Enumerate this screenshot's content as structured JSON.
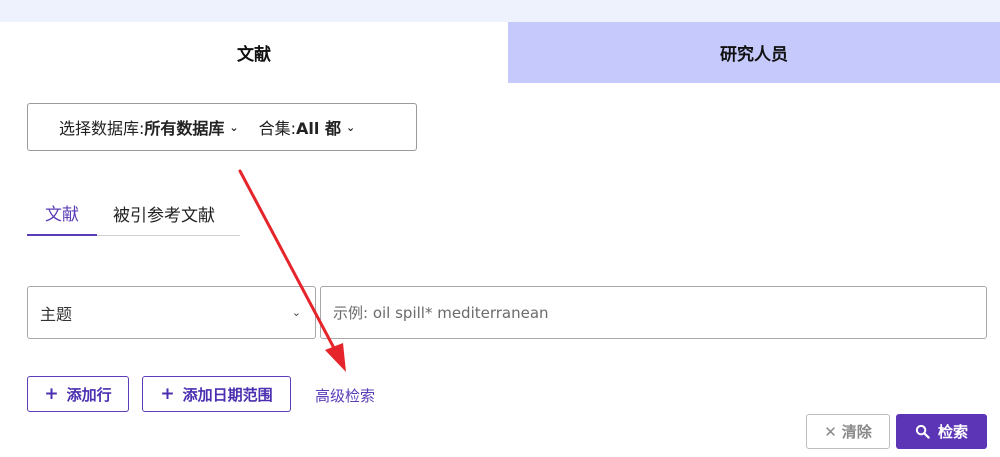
{
  "colors": {
    "accent": "#5b3db8",
    "inactive_tab": "#c5c9fb",
    "annotation_arrow": "#e5252b"
  },
  "main_tabs": [
    {
      "label": "文献",
      "active": true
    },
    {
      "label": "研究人员",
      "active": false
    }
  ],
  "db_selector": {
    "db_label": "选择数据库: ",
    "db_value": "所有数据库",
    "collection_label": "合集: ",
    "collection_value": "All 都"
  },
  "sub_tabs": [
    {
      "label": "文献",
      "active": true
    },
    {
      "label": "被引参考文献",
      "active": false
    }
  ],
  "search_row": {
    "field_value": "主题",
    "placeholder": "示例: oil spill* mediterranean"
  },
  "actions": {
    "add_row": "添加行",
    "add_date_range": "添加日期范围",
    "advanced_search": "高级检索",
    "clear": "清除",
    "search": "检索"
  },
  "icons": {
    "chevron": "chevron-down-icon",
    "plus": "plus-icon",
    "close": "close-icon",
    "search": "search-icon"
  }
}
